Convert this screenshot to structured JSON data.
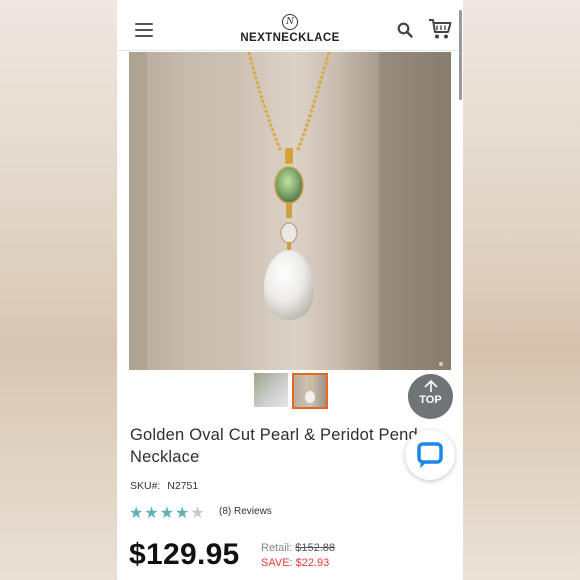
{
  "header": {
    "brand": "NEXTNECKLACE",
    "logo_mark": "N",
    "menu_icon": "hamburger-menu-icon",
    "search_icon": "search-icon",
    "cart_icon": "shopping-cart-icon"
  },
  "gallery": {
    "thumbnails": [
      "thumb-1",
      "thumb-2"
    ],
    "selected_index": 1,
    "selected_border_color": "#e9661e"
  },
  "top_button": {
    "label": "TOP",
    "icon": "arrow-up-icon"
  },
  "chat_button": {
    "icon": "chat-bubble-icon",
    "color": "#1e88e5"
  },
  "product": {
    "title_line1": "Golden Oval Cut Pearl & Peridot Pend",
    "title_line2": "Necklace",
    "sku_label": "SKU#:",
    "sku": "N2751",
    "rating": 4,
    "rating_max": 5,
    "reviews": "(8) Reviews",
    "price": "$129.95",
    "retail_label": "Retail:",
    "retail_price": "$152.88",
    "save_text": "SAVE: $22.93"
  },
  "colors": {
    "star_filled": "#5fb1b3",
    "star_empty": "#c7c7c7",
    "save_red": "#e53935",
    "top_button_bg": "#6f7476"
  }
}
